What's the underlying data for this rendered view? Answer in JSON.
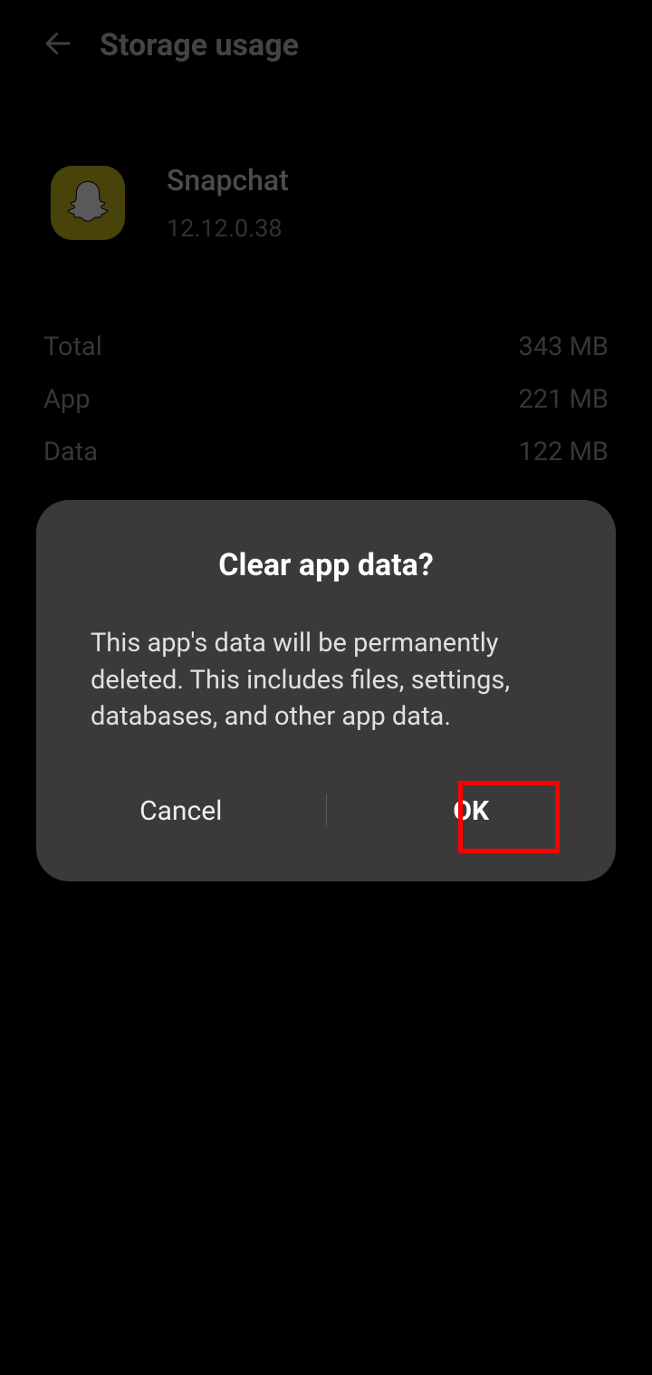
{
  "header": {
    "title": "Storage usage"
  },
  "app": {
    "name": "Snapchat",
    "version": "12.12.0.38"
  },
  "stats": [
    {
      "label": "Total",
      "value": "343 MB"
    },
    {
      "label": "App",
      "value": "221 MB"
    },
    {
      "label": "Data",
      "value": "122 MB"
    }
  ],
  "dialog": {
    "title": "Clear app data?",
    "body": "This app's data will be permanently deleted. This includes files, settings, databases, and other app data.",
    "cancel": "Cancel",
    "ok": "OK"
  }
}
